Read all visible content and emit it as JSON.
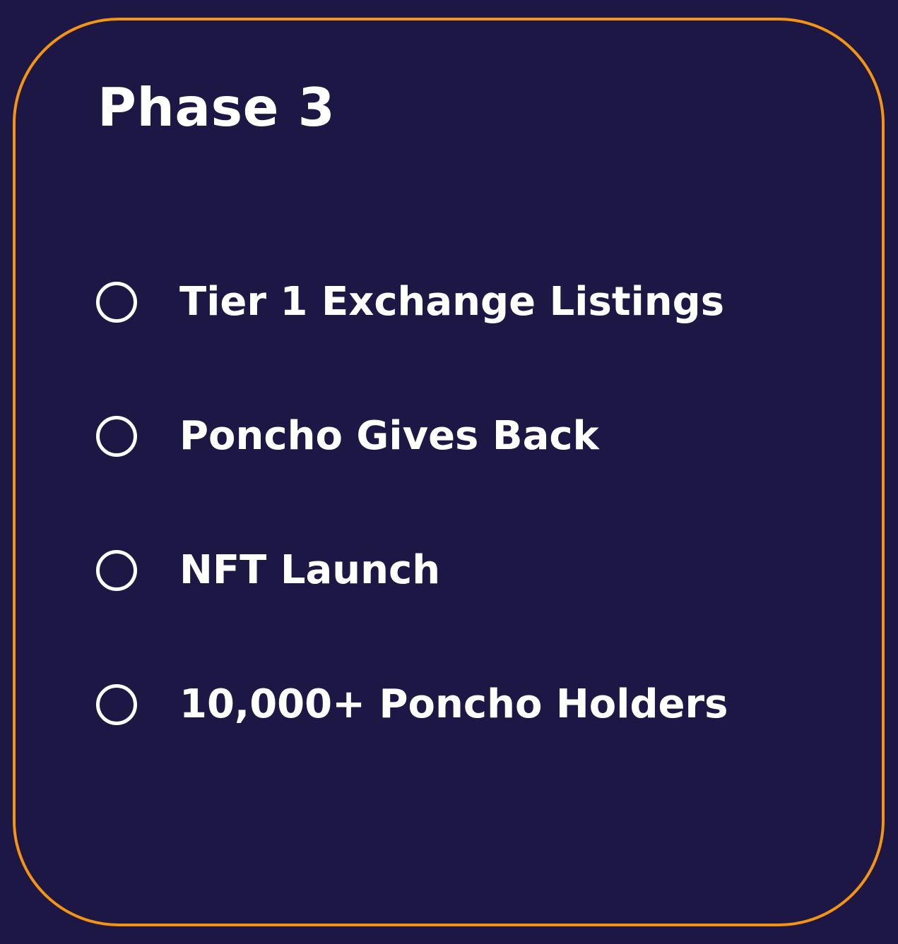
{
  "card": {
    "title": "Phase 3",
    "border_color": "#f39412",
    "background_color": "#1c1745",
    "items": [
      {
        "label": "Tier 1 Exchange Listings",
        "icon": "empty-circle-icon",
        "completed": false
      },
      {
        "label": "Poncho Gives Back",
        "icon": "empty-circle-icon",
        "completed": false
      },
      {
        "label": "NFT Launch",
        "icon": "empty-circle-icon",
        "completed": false
      },
      {
        "label": "10,000+ Poncho Holders",
        "icon": "empty-circle-icon",
        "completed": false
      }
    ]
  }
}
